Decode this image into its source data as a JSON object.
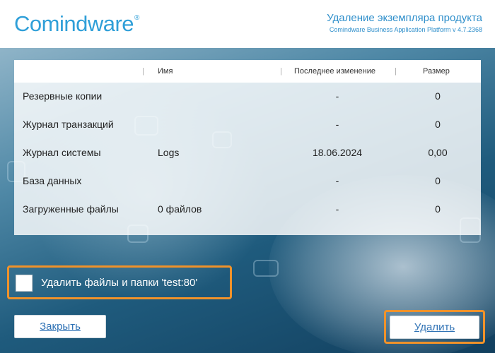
{
  "header": {
    "logo_text": "Comindware",
    "logo_reg": "®",
    "title": "Удаление экземпляра продукта",
    "subtitle": "Comindware Business Application Platform v 4.7.2368"
  },
  "table": {
    "columns": [
      "Имя",
      "Последнее изменение",
      "Размер"
    ],
    "column_separator": "|",
    "rows": [
      {
        "category": "Резервные копии",
        "name": "",
        "modified": "-",
        "size": "0"
      },
      {
        "category": "Журнал транзакций",
        "name": "",
        "modified": "-",
        "size": "0"
      },
      {
        "category": "Журнал системы",
        "name": "Logs",
        "modified": "18.06.2024",
        "size": "0,00"
      },
      {
        "category": "База данных",
        "name": "",
        "modified": "-",
        "size": "0"
      },
      {
        "category": "Загруженные файлы",
        "name": "0 файлов",
        "modified": "-",
        "size": "0"
      }
    ]
  },
  "delete_checkbox": {
    "label": "Удалить файлы и папки  'test:80'",
    "checked": false
  },
  "buttons": {
    "close": "Закрыть",
    "delete": "Удалить"
  },
  "colors": {
    "brand": "#2f9fd8",
    "highlight": "#f0922a",
    "link": "#2f72b5"
  }
}
